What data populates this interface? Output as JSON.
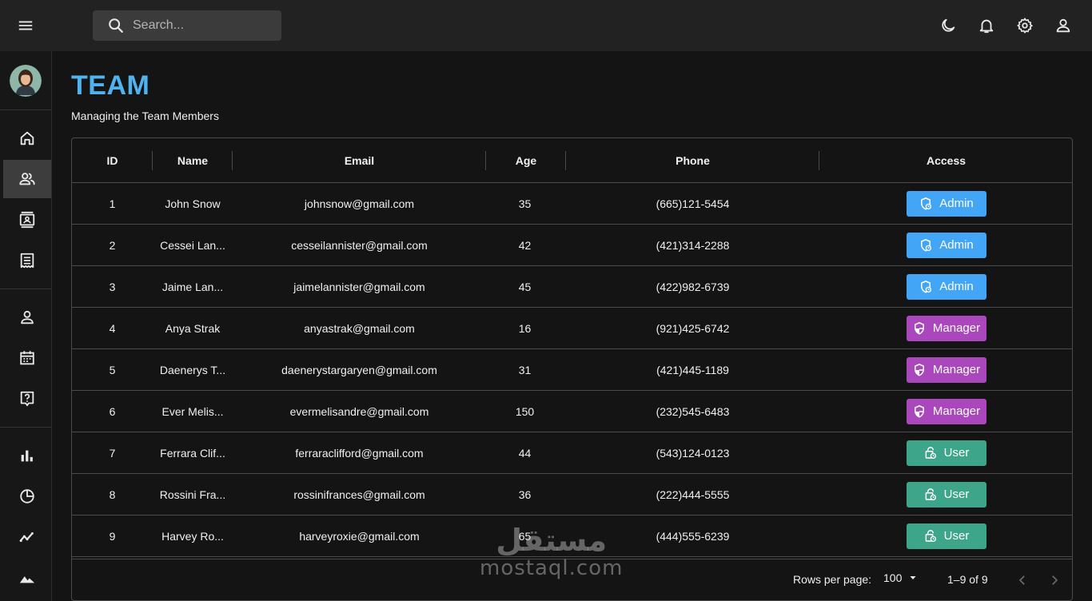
{
  "topbar": {
    "search_placeholder": "Search..."
  },
  "page": {
    "title": "TEAM",
    "subtitle": "Managing the Team Members"
  },
  "colors": {
    "accent": "#4fb3f0",
    "admin": "#42a5f5",
    "manager": "#ab47bc",
    "user": "#3da58a"
  },
  "table": {
    "headers": [
      "ID",
      "Name",
      "Email",
      "Age",
      "Phone",
      "Access"
    ],
    "rows": [
      {
        "id": "1",
        "name": "John Snow",
        "email": "johnsnow@gmail.com",
        "age": "35",
        "phone": "(665)121-5454",
        "access": "Admin",
        "access_type": "admin"
      },
      {
        "id": "2",
        "name": "Cessei Lan...",
        "email": "cesseilannister@gmail.com",
        "age": "42",
        "phone": "(421)314-2288",
        "access": "Admin",
        "access_type": "admin"
      },
      {
        "id": "3",
        "name": "Jaime Lan...",
        "email": "jaimelannister@gmail.com",
        "age": "45",
        "phone": "(422)982-6739",
        "access": "Admin",
        "access_type": "admin"
      },
      {
        "id": "4",
        "name": "Anya Strak",
        "email": "anyastrak@gmail.com",
        "age": "16",
        "phone": "(921)425-6742",
        "access": "Manager",
        "access_type": "manager"
      },
      {
        "id": "5",
        "name": "Daenerys T...",
        "email": "daenerystargaryen@gmail.com",
        "age": "31",
        "phone": "(421)445-1189",
        "access": "Manager",
        "access_type": "manager"
      },
      {
        "id": "6",
        "name": "Ever Melis...",
        "email": "evermelisandre@gmail.com",
        "age": "150",
        "phone": "(232)545-6483",
        "access": "Manager",
        "access_type": "manager"
      },
      {
        "id": "7",
        "name": "Ferrara Clif...",
        "email": "ferraraclifford@gmail.com",
        "age": "44",
        "phone": "(543)124-0123",
        "access": "User",
        "access_type": "user"
      },
      {
        "id": "8",
        "name": "Rossini Fra...",
        "email": "rossinifrances@gmail.com",
        "age": "36",
        "phone": "(222)444-5555",
        "access": "User",
        "access_type": "user"
      },
      {
        "id": "9",
        "name": "Harvey Ro...",
        "email": "harveyroxie@gmail.com",
        "age": "65",
        "phone": "(444)555-6239",
        "access": "User",
        "access_type": "user"
      }
    ]
  },
  "pagination": {
    "rows_per_page_label": "Rows per page:",
    "rows_per_page_value": "100",
    "range_label": "1–9 of 9"
  },
  "watermark": {
    "arabic": "مستقل",
    "latin": "mostaql.com"
  }
}
